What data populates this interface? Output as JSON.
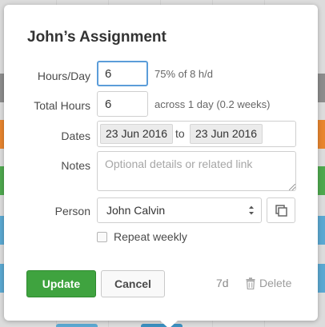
{
  "dialog": {
    "title": "John’s Assignment"
  },
  "fields": {
    "hours_per_day": {
      "label": "Hours/Day",
      "value": "6",
      "hint": "75% of 8 h/d"
    },
    "total_hours": {
      "label": "Total Hours",
      "value": "6",
      "hint": "across 1 day (0.2 weeks)"
    },
    "dates": {
      "label": "Dates",
      "start": "23 Jun 2016",
      "separator": "to",
      "end": "23 Jun 2016"
    },
    "notes": {
      "label": "Notes",
      "placeholder": "Optional details or related link",
      "value": ""
    },
    "person": {
      "label": "Person",
      "selected": "John Calvin"
    },
    "repeat": {
      "label": "Repeat weekly",
      "checked": false
    }
  },
  "footer": {
    "update_label": "Update",
    "cancel_label": "Cancel",
    "duration": "7d",
    "delete_label": "Delete"
  },
  "icons": {
    "select_caret": "up-down-caret-icon",
    "copy": "copy-icon",
    "delete": "trash-icon"
  },
  "colors": {
    "update_button": "#3fa33f",
    "focus_ring": "#5b9dd9",
    "background_bars": [
      "#8c8c8c",
      "#e8852e",
      "#4ea84e",
      "#5ba8d2",
      "#5ba8d2"
    ]
  }
}
